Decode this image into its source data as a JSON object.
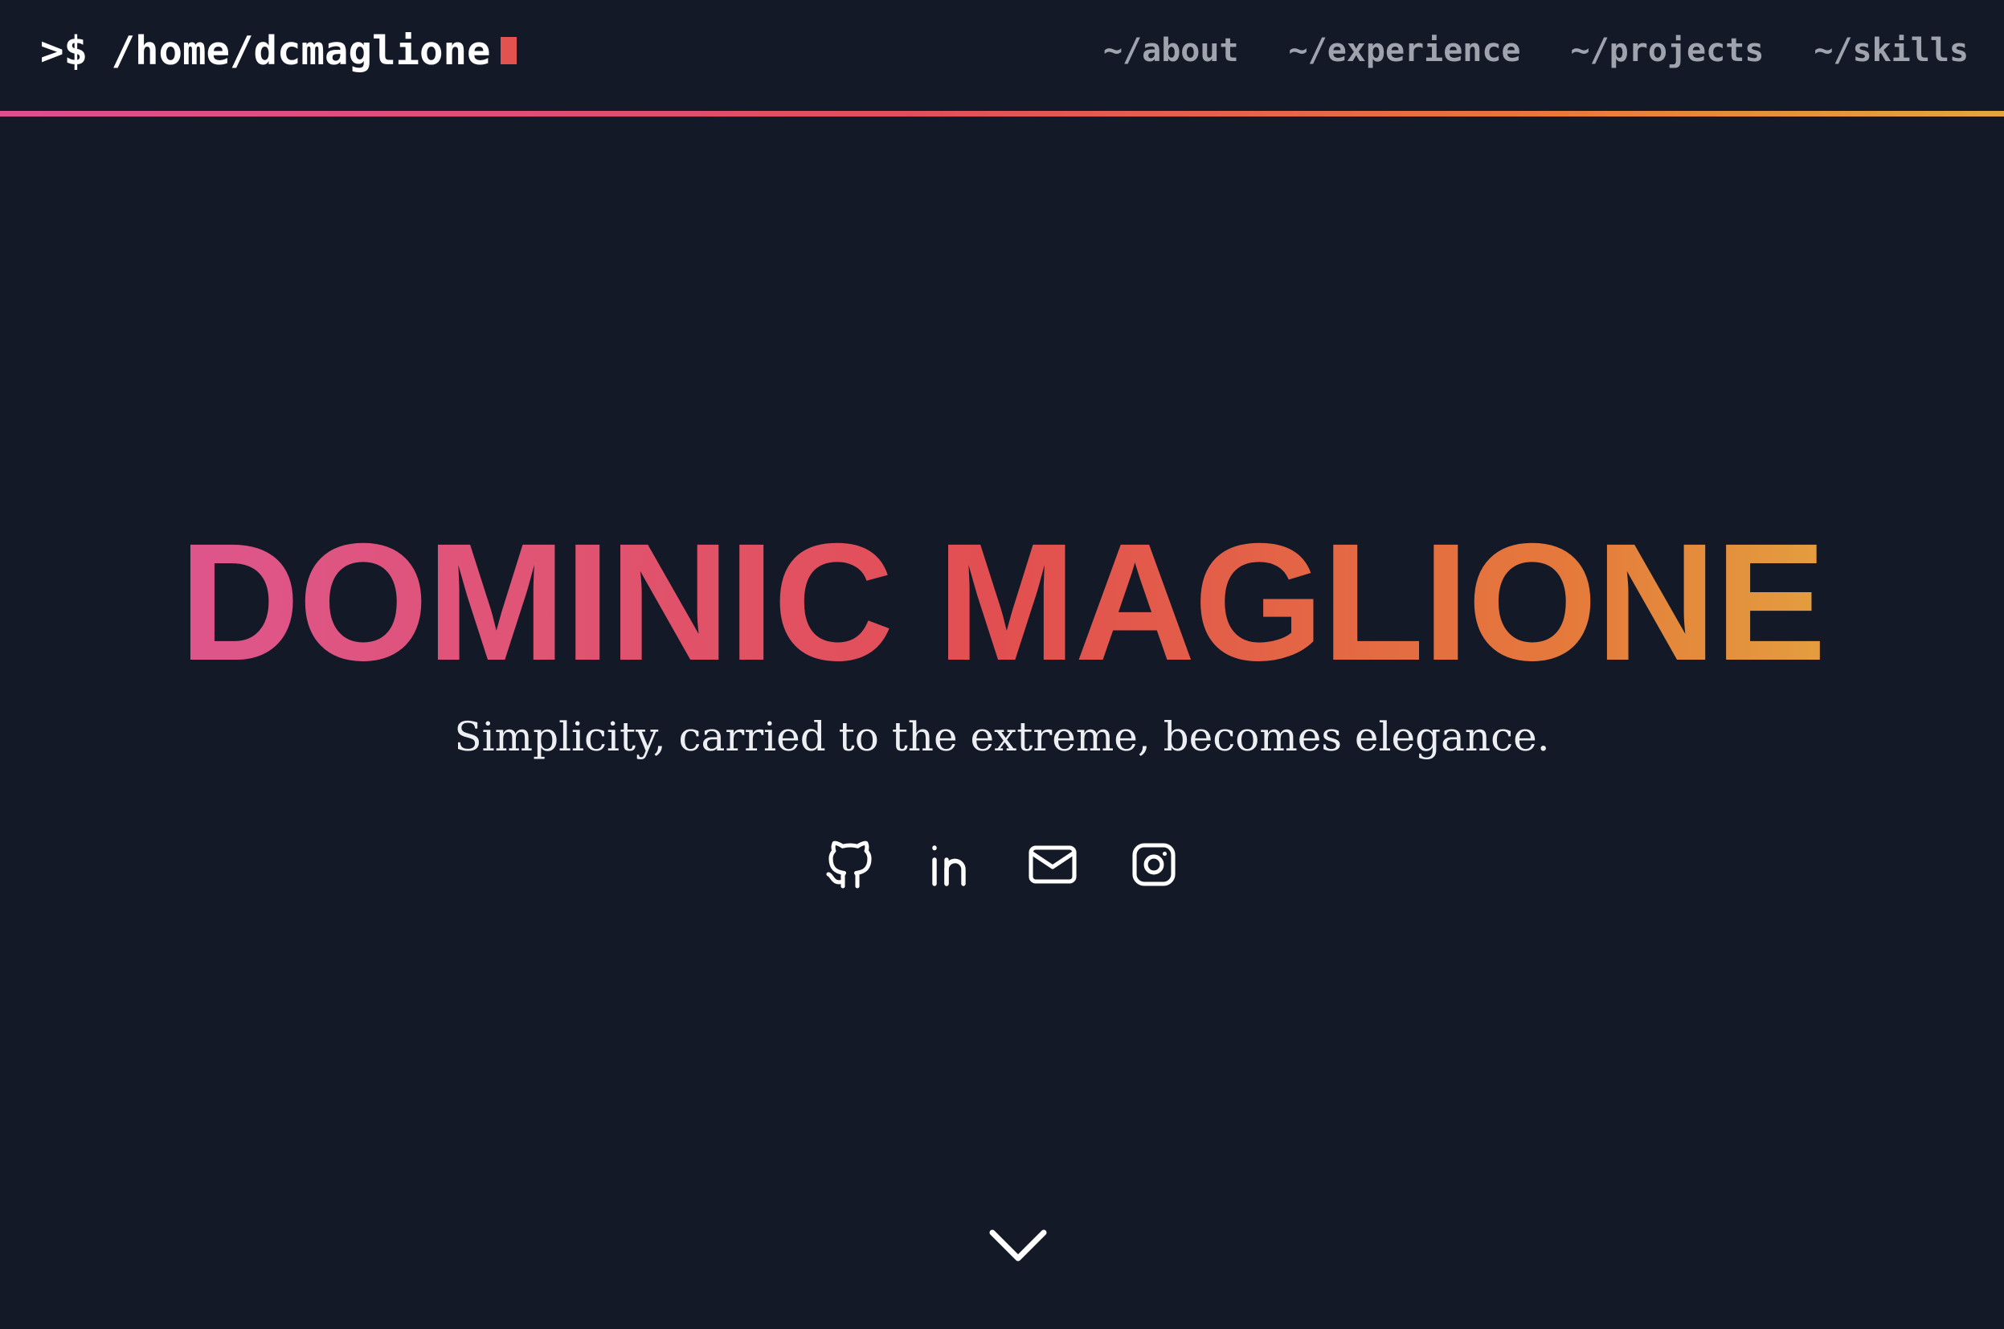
{
  "nav": {
    "brand": ">$ /home/dcmaglione",
    "links": [
      "~/about",
      "~/experience",
      "~/projects",
      "~/skills"
    ]
  },
  "hero": {
    "name": "DOMINIC MAGLIONE",
    "tagline": "Simplicity, carried to the extreme, becomes elegance.",
    "social_icons": [
      "github-icon",
      "linkedin-icon",
      "email-icon",
      "instagram-icon"
    ],
    "scroll_icon": "chevron-down-icon"
  },
  "colors": {
    "background": "#141927",
    "cursor": "#e2524e",
    "nav_link": "#9ea3ad",
    "gradient_start": "#dc5698",
    "gradient_mid": "#e24f51",
    "gradient_end": "#e3b740"
  }
}
